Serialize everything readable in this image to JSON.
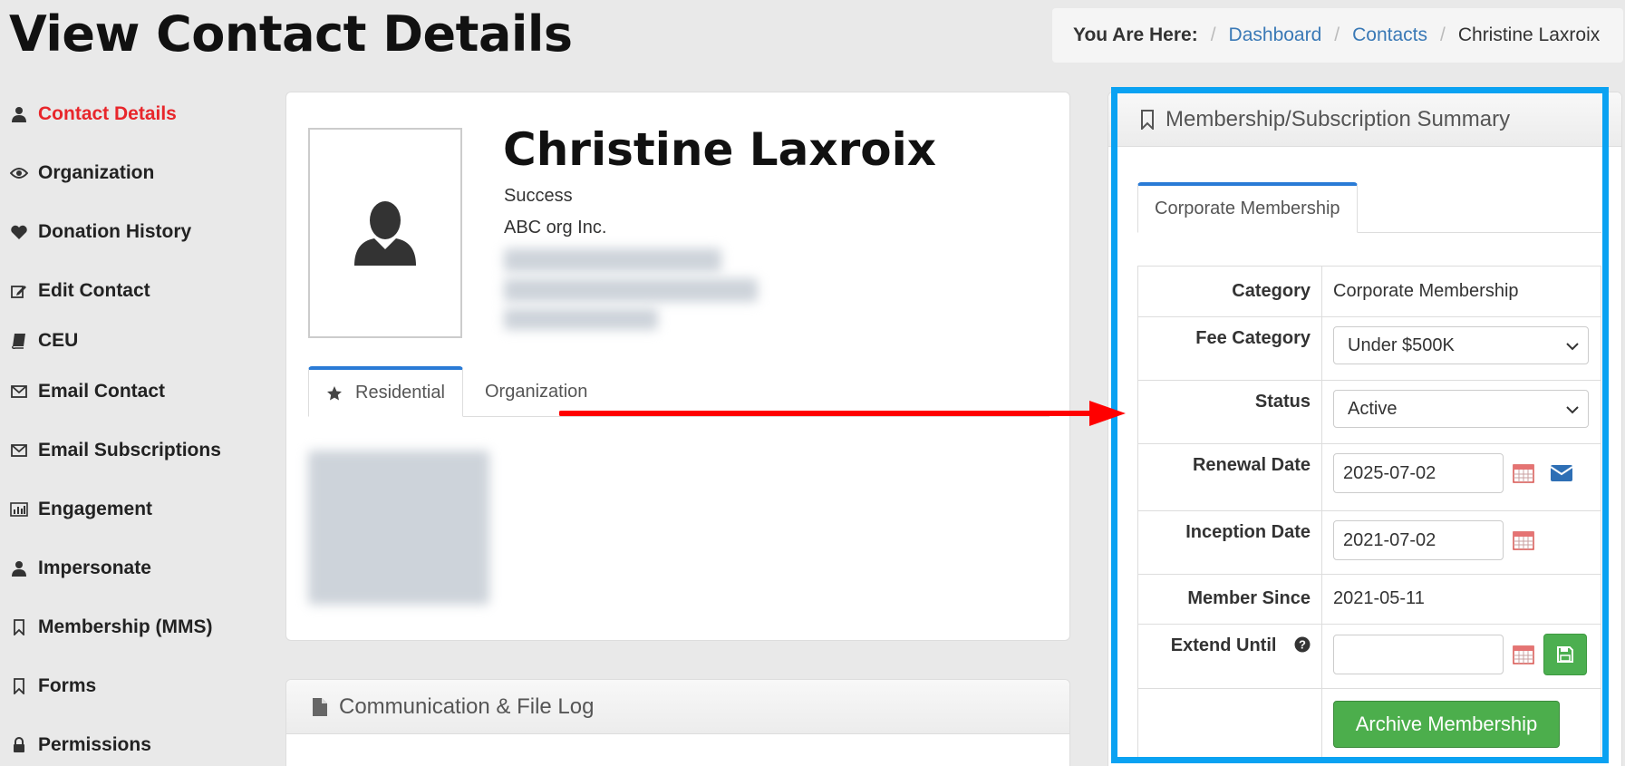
{
  "page": {
    "title": "View Contact Details"
  },
  "breadcrumb": {
    "label": "You Are Here:",
    "items": [
      "Dashboard",
      "Contacts",
      "Christine Laxroix"
    ]
  },
  "sidebar": {
    "items": [
      {
        "label": "Contact Details",
        "icon": "user-icon"
      },
      {
        "label": "Organization",
        "icon": "eye-icon"
      },
      {
        "label": "Donation History",
        "icon": "heart-icon"
      },
      {
        "label": "Edit Contact",
        "icon": "edit-icon"
      },
      {
        "label": "CEU",
        "icon": "book-icon"
      },
      {
        "label": "Email Contact",
        "icon": "envelope-icon"
      },
      {
        "label": "Email Subscriptions",
        "icon": "envelope-icon"
      },
      {
        "label": "Engagement",
        "icon": "bar-chart-icon"
      },
      {
        "label": "Impersonate",
        "icon": "user-icon"
      },
      {
        "label": "Membership (MMS)",
        "icon": "bookmark-icon"
      },
      {
        "label": "Forms",
        "icon": "bookmark-icon"
      },
      {
        "label": "Permissions",
        "icon": "lock-icon"
      }
    ]
  },
  "contact": {
    "name": "Christine Laxroix",
    "status": "Success",
    "organization": "ABC org Inc.",
    "tabs": [
      "Residential",
      "Organization"
    ]
  },
  "log": {
    "title": "Communication & File Log"
  },
  "membership": {
    "title": "Membership/Subscription Summary",
    "tab": "Corporate Membership",
    "labels": {
      "category": "Category",
      "fee_category": "Fee Category",
      "status": "Status",
      "renewal_date": "Renewal Date",
      "inception_date": "Inception Date",
      "member_since": "Member Since",
      "extend_until": "Extend Until"
    },
    "values": {
      "category": "Corporate Membership",
      "fee_category": "Under $500K",
      "status": "Active",
      "renewal_date": "2025-07-02",
      "inception_date": "2021-07-02",
      "member_since": "2021-05-11",
      "extend_until": ""
    },
    "archive_label": "Archive Membership"
  },
  "colors": {
    "active_nav": "#e8262b",
    "link": "#3a79b6",
    "highlight": "#0aa2f2",
    "arrow": "#ff0000",
    "success_button": "#4cae4c"
  }
}
